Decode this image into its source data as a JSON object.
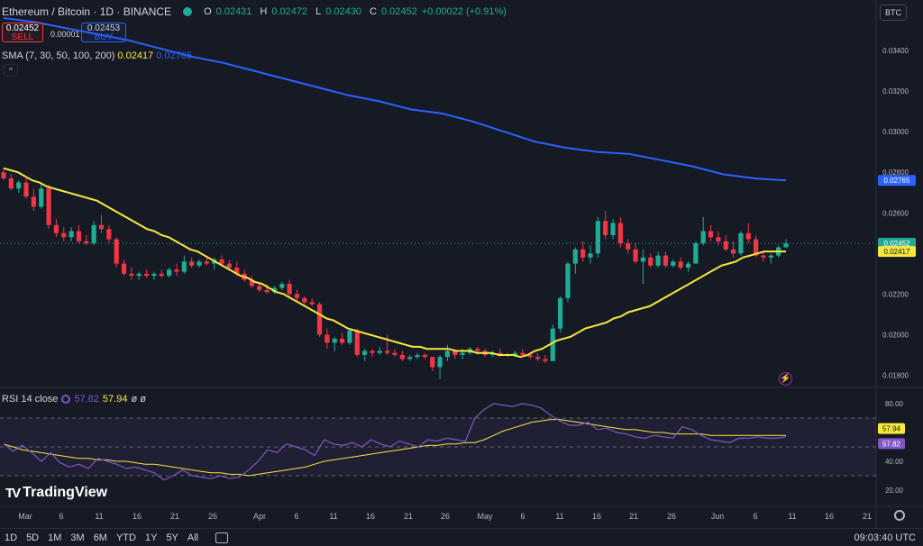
{
  "header": {
    "symbol": "Ethereum / Bitcoin · 1D · BINANCE",
    "ohlc": {
      "o_label": "O",
      "o": "0.02431",
      "h_label": "H",
      "h": "0.02472",
      "l_label": "L",
      "l": "0.02430",
      "c_label": "C",
      "c": "0.02452",
      "change": "+0.00022 (+0.91%)"
    },
    "sell": {
      "price": "0.02452",
      "label": "SELL"
    },
    "spread": "0.00001",
    "buy": {
      "price": "0.02453",
      "label": "BUY"
    },
    "sma_label": "SMA (7, 30, 50, 100, 200)",
    "sma_val_1": "0.02417",
    "sma_val_2": "0.02765",
    "currency": "BTC",
    "collapse": "^"
  },
  "price_axis": {
    "ticks": [
      "0.03400",
      "0.03200",
      "0.03000",
      "0.02800",
      "0.02600",
      "0.02400",
      "0.02200",
      "0.02000",
      "0.01800"
    ],
    "badges": [
      {
        "label": "0.02765",
        "color": "#2962ff",
        "text_color": "#ffffff"
      },
      {
        "label": "0.02452",
        "color": "#22ab94",
        "text_color": "#ffffff"
      },
      {
        "label": "0.02417",
        "color": "#f7e83d",
        "text_color": "#131722"
      }
    ]
  },
  "rsi": {
    "label": "RSI 14 close",
    "val1": "57.82",
    "val2": "57.94",
    "ext": "ø ø",
    "ticks": [
      "80.00",
      "40.00",
      "20.00"
    ],
    "badges": [
      {
        "label": "57.94",
        "color": "#f7e83d",
        "text_color": "#131722"
      },
      {
        "label": "57.82",
        "color": "#7e57c2",
        "text_color": "#ffffff"
      }
    ]
  },
  "time_axis": [
    "Mar",
    "6",
    "11",
    "16",
    "21",
    "26",
    "Apr",
    "6",
    "11",
    "16",
    "21",
    "26",
    "May",
    "6",
    "11",
    "16",
    "21",
    "26",
    "Jun",
    "6",
    "11",
    "16",
    "21"
  ],
  "bottom_bar": {
    "ranges": [
      "1D",
      "5D",
      "1M",
      "3M",
      "6M",
      "YTD",
      "1Y",
      "5Y",
      "All"
    ],
    "clock": "09:03:40 UTC"
  },
  "brand": "TradingView",
  "colors": {
    "up": "#22ab94",
    "down": "#f23645",
    "sma200": "#2962ff",
    "sma50": "#f7e83d",
    "rsi": "#7e57c2"
  },
  "chart_data": {
    "type": "candlestick",
    "title": "Ethereum / Bitcoin · 1D · BINANCE",
    "ylim": [
      0.0174,
      0.0356
    ],
    "candles": [
      [
        0.028,
        0.0282,
        0.0276,
        0.0277
      ],
      [
        0.0277,
        0.0279,
        0.0271,
        0.0272
      ],
      [
        0.0272,
        0.0276,
        0.027,
        0.0275
      ],
      [
        0.0275,
        0.0277,
        0.0267,
        0.0268
      ],
      [
        0.0268,
        0.0272,
        0.0261,
        0.0263
      ],
      [
        0.0263,
        0.0274,
        0.0262,
        0.0272
      ],
      [
        0.0272,
        0.0274,
        0.0252,
        0.0254
      ],
      [
        0.0254,
        0.0257,
        0.0248,
        0.025
      ],
      [
        0.025,
        0.0253,
        0.0246,
        0.0248
      ],
      [
        0.0248,
        0.0253,
        0.0246,
        0.0251
      ],
      [
        0.0251,
        0.0254,
        0.0245,
        0.0246
      ],
      [
        0.0246,
        0.0249,
        0.0244,
        0.0245
      ],
      [
        0.0245,
        0.0256,
        0.0244,
        0.0254
      ],
      [
        0.0254,
        0.0259,
        0.025,
        0.0252
      ],
      [
        0.0252,
        0.0254,
        0.0245,
        0.0247
      ],
      [
        0.0247,
        0.0248,
        0.0233,
        0.0235
      ],
      [
        0.0235,
        0.0237,
        0.0229,
        0.023
      ],
      [
        0.023,
        0.0233,
        0.0227,
        0.0229
      ],
      [
        0.0229,
        0.0231,
        0.0227,
        0.023
      ],
      [
        0.023,
        0.0232,
        0.0228,
        0.0229
      ],
      [
        0.0229,
        0.0231,
        0.0227,
        0.023
      ],
      [
        0.023,
        0.0232,
        0.0228,
        0.0229
      ],
      [
        0.0229,
        0.0233,
        0.0228,
        0.0232
      ],
      [
        0.0232,
        0.0235,
        0.0229,
        0.0231
      ],
      [
        0.0231,
        0.0239,
        0.023,
        0.0236
      ],
      [
        0.0236,
        0.0238,
        0.0233,
        0.0234
      ],
      [
        0.0234,
        0.0237,
        0.0233,
        0.0236
      ],
      [
        0.0236,
        0.0238,
        0.0234,
        0.0235
      ],
      [
        0.0235,
        0.0238,
        0.0232,
        0.0237
      ],
      [
        0.0237,
        0.0239,
        0.0234,
        0.0235
      ],
      [
        0.0235,
        0.0237,
        0.0232,
        0.0233
      ],
      [
        0.0233,
        0.0236,
        0.0229,
        0.023
      ],
      [
        0.023,
        0.0232,
        0.0226,
        0.0227
      ],
      [
        0.0227,
        0.0229,
        0.0223,
        0.0224
      ],
      [
        0.0224,
        0.0226,
        0.0221,
        0.0222
      ],
      [
        0.0222,
        0.0225,
        0.022,
        0.0221
      ],
      [
        0.0221,
        0.0224,
        0.022,
        0.0223
      ],
      [
        0.0223,
        0.0226,
        0.0222,
        0.0225
      ],
      [
        0.0225,
        0.0227,
        0.0219,
        0.022
      ],
      [
        0.022,
        0.0222,
        0.0216,
        0.0218
      ],
      [
        0.0218,
        0.0219,
        0.0215,
        0.0216
      ],
      [
        0.0216,
        0.0218,
        0.0214,
        0.0215
      ],
      [
        0.0215,
        0.0216,
        0.0199,
        0.02
      ],
      [
        0.02,
        0.0203,
        0.0193,
        0.0196
      ],
      [
        0.0196,
        0.0199,
        0.0192,
        0.0198
      ],
      [
        0.0198,
        0.0201,
        0.0195,
        0.0196
      ],
      [
        0.0196,
        0.0203,
        0.0195,
        0.0202
      ],
      [
        0.0202,
        0.0203,
        0.0189,
        0.019
      ],
      [
        0.019,
        0.0193,
        0.0187,
        0.0192
      ],
      [
        0.0192,
        0.0193,
        0.0189,
        0.0191
      ],
      [
        0.0191,
        0.0194,
        0.019,
        0.0192
      ],
      [
        0.0192,
        0.02,
        0.019,
        0.0191
      ],
      [
        0.0191,
        0.0193,
        0.0189,
        0.019
      ],
      [
        0.019,
        0.0192,
        0.0187,
        0.0188
      ],
      [
        0.0188,
        0.019,
        0.0187,
        0.0189
      ],
      [
        0.0189,
        0.0191,
        0.0188,
        0.019
      ],
      [
        0.019,
        0.0191,
        0.0188,
        0.0189
      ],
      [
        0.0189,
        0.0189,
        0.0182,
        0.0184
      ],
      [
        0.0184,
        0.019,
        0.0178,
        0.0189
      ],
      [
        0.0189,
        0.0195,
        0.0187,
        0.0192
      ],
      [
        0.0192,
        0.0193,
        0.0188,
        0.019
      ],
      [
        0.019,
        0.0193,
        0.0188,
        0.0191
      ],
      [
        0.0191,
        0.0194,
        0.019,
        0.0193
      ],
      [
        0.0193,
        0.0194,
        0.019,
        0.0192
      ],
      [
        0.0192,
        0.0193,
        0.0189,
        0.019
      ],
      [
        0.019,
        0.0192,
        0.0189,
        0.0191
      ],
      [
        0.0191,
        0.0193,
        0.0189,
        0.019
      ],
      [
        0.019,
        0.0191,
        0.0189,
        0.019
      ],
      [
        0.019,
        0.0192,
        0.0189,
        0.0191
      ],
      [
        0.0191,
        0.0193,
        0.0189,
        0.019
      ],
      [
        0.019,
        0.0191,
        0.0188,
        0.0189
      ],
      [
        0.0189,
        0.0191,
        0.0187,
        0.0188
      ],
      [
        0.0188,
        0.019,
        0.0186,
        0.0187
      ],
      [
        0.0187,
        0.0205,
        0.0187,
        0.0203
      ],
      [
        0.0203,
        0.0219,
        0.0201,
        0.0218
      ],
      [
        0.0218,
        0.0236,
        0.0216,
        0.0235
      ],
      [
        0.0235,
        0.0243,
        0.023,
        0.0242
      ],
      [
        0.0242,
        0.0246,
        0.0236,
        0.0238
      ],
      [
        0.0238,
        0.0244,
        0.0235,
        0.024
      ],
      [
        0.024,
        0.0258,
        0.0238,
        0.0256
      ],
      [
        0.0256,
        0.0261,
        0.0247,
        0.0249
      ],
      [
        0.0249,
        0.0257,
        0.0247,
        0.0255
      ],
      [
        0.0255,
        0.0258,
        0.0243,
        0.0245
      ],
      [
        0.0245,
        0.0247,
        0.024,
        0.0242
      ],
      [
        0.0242,
        0.0245,
        0.0235,
        0.0236
      ],
      [
        0.0236,
        0.0242,
        0.0225,
        0.0238
      ],
      [
        0.0238,
        0.024,
        0.0233,
        0.0234
      ],
      [
        0.0234,
        0.0241,
        0.0233,
        0.0239
      ],
      [
        0.0239,
        0.0241,
        0.0233,
        0.0234
      ],
      [
        0.0234,
        0.0237,
        0.0233,
        0.0236
      ],
      [
        0.0236,
        0.0238,
        0.0232,
        0.0233
      ],
      [
        0.0233,
        0.0236,
        0.0231,
        0.0235
      ],
      [
        0.0235,
        0.0246,
        0.0235,
        0.0245
      ],
      [
        0.0245,
        0.0258,
        0.0244,
        0.0251
      ],
      [
        0.0251,
        0.0254,
        0.0246,
        0.0248
      ],
      [
        0.0248,
        0.0251,
        0.0244,
        0.0246
      ],
      [
        0.0246,
        0.0249,
        0.0241,
        0.0242
      ],
      [
        0.0242,
        0.0246,
        0.0238,
        0.024
      ],
      [
        0.024,
        0.0251,
        0.0239,
        0.025
      ],
      [
        0.025,
        0.0255,
        0.0245,
        0.0247
      ],
      [
        0.0247,
        0.0249,
        0.0238,
        0.0239
      ],
      [
        0.0239,
        0.0241,
        0.0236,
        0.0238
      ],
      [
        0.0238,
        0.024,
        0.0235,
        0.0239
      ],
      [
        0.0239,
        0.0244,
        0.0238,
        0.0243
      ],
      [
        0.0243,
        0.0247,
        0.0243,
        0.0245
      ]
    ],
    "sma50": [
      0.0282,
      0.0281,
      0.028,
      0.0278,
      0.0276,
      0.0275,
      0.0273,
      0.0272,
      0.0271,
      0.027,
      0.0269,
      0.0268,
      0.0267,
      0.0266,
      0.0264,
      0.0262,
      0.026,
      0.0258,
      0.0256,
      0.0254,
      0.0252,
      0.0251,
      0.0249,
      0.0248,
      0.0246,
      0.0244,
      0.0242,
      0.0241,
      0.0239,
      0.0237,
      0.0235,
      0.0233,
      0.0231,
      0.0229,
      0.0228,
      0.0226,
      0.0225,
      0.0223,
      0.0221,
      0.022,
      0.0218,
      0.0216,
      0.0214,
      0.0212,
      0.021,
      0.0208,
      0.0207,
      0.0205,
      0.0203,
      0.0202,
      0.0201,
      0.02,
      0.0199,
      0.0198,
      0.0197,
      0.0196,
      0.0195,
      0.0194,
      0.0194,
      0.0193,
      0.0193,
      0.0193,
      0.0193,
      0.0192,
      0.0192,
      0.0192,
      0.0191,
      0.0191,
      0.0191,
      0.019,
      0.019,
      0.019,
      0.0189,
      0.019,
      0.0192,
      0.0193,
      0.0195,
      0.0197,
      0.0198,
      0.0199,
      0.0201,
      0.0203,
      0.0204,
      0.0205,
      0.0206,
      0.0208,
      0.0209,
      0.0211,
      0.0212,
      0.0213,
      0.0214,
      0.0216,
      0.0218,
      0.022,
      0.0222,
      0.0224,
      0.0226,
      0.0228,
      0.023,
      0.0232,
      0.0234,
      0.0235,
      0.0236,
      0.0238,
      0.0239,
      0.024,
      0.0241,
      0.0241,
      0.0241,
      0.0241
    ],
    "sma200": [
      0.0356,
      0.0354,
      0.0351,
      0.0348,
      0.0345,
      0.0341,
      0.0337,
      0.0334,
      0.033,
      0.0326,
      0.0322,
      0.0318,
      0.0315,
      0.0311,
      0.0309,
      0.0305,
      0.03,
      0.0295,
      0.0292,
      0.029,
      0.0289,
      0.0286,
      0.0283,
      0.0279,
      0.0277,
      0.0276
    ],
    "rsi": [
      52,
      47,
      51,
      46,
      40,
      46,
      39,
      36,
      38,
      35,
      42,
      40,
      38,
      35,
      36,
      34,
      32,
      27,
      30,
      34,
      30,
      29,
      28,
      30,
      28,
      29,
      34,
      40,
      48,
      46,
      52,
      50,
      48,
      44,
      55,
      52,
      51,
      53,
      50,
      55,
      52,
      50,
      54,
      52,
      50,
      55,
      54,
      56,
      55,
      54,
      70,
      76,
      80,
      79,
      78,
      80,
      79,
      77,
      72,
      68,
      65,
      65,
      67,
      62,
      63,
      60,
      59,
      57,
      56,
      58,
      57,
      56,
      64,
      62,
      58,
      55,
      54,
      53,
      56,
      56,
      57,
      56,
      56,
      57
    ],
    "rsi_ma": [
      52,
      50,
      48,
      47,
      46,
      45,
      44,
      43,
      42,
      42,
      41,
      41,
      40,
      40,
      39,
      38,
      38,
      37,
      36,
      35,
      34,
      33,
      32,
      32,
      31,
      31,
      30,
      31,
      32,
      33,
      34,
      35,
      36,
      38,
      40,
      41,
      42,
      43,
      44,
      45,
      46,
      47,
      48,
      49,
      50,
      51,
      51,
      52,
      52,
      53,
      53,
      55,
      58,
      61,
      63,
      65,
      67,
      68,
      69,
      69,
      68,
      67,
      66,
      65,
      64,
      63,
      62,
      62,
      61,
      60,
      60,
      59,
      59,
      59,
      59,
      58,
      58,
      58,
      58,
      58,
      58,
      58,
      58,
      58
    ]
  }
}
